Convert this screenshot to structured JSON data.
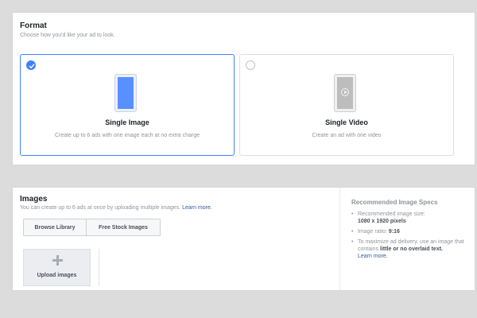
{
  "format": {
    "title": "Format",
    "subtitle": "Choose how you'd like your ad to look.",
    "options": [
      {
        "title": "Single Image",
        "description": "Create up to 6 ads with one image each at no extra charge",
        "selected": true,
        "icon": "phone-image-icon"
      },
      {
        "title": "Single Video",
        "description": "Create an ad with one video",
        "selected": false,
        "icon": "phone-video-icon"
      }
    ]
  },
  "images": {
    "title": "Images",
    "subtitle": "You can create up to 6 ads at once by uploading multiple images.",
    "learn_more": "Learn more.",
    "browse_label": "Browse Library",
    "stock_label": "Free Stock Images",
    "upload_label": "Upload images",
    "upload_icon": "plus-icon"
  },
  "specs": {
    "title": "Recommended Image Specs",
    "size_label": "Recommended image size:",
    "size_value": "1080 x 1920 pixels",
    "ratio_label": "Image ratio:",
    "ratio_value": "9:16",
    "delivery_text": "To maximize ad delivery, use an image that contains",
    "delivery_strong": "little or no overlaid text.",
    "learn_more": "Learn more."
  },
  "colors": {
    "accent": "#4080ff",
    "link": "#365899",
    "muted": "#90949c",
    "background": "#dcdcdc"
  }
}
